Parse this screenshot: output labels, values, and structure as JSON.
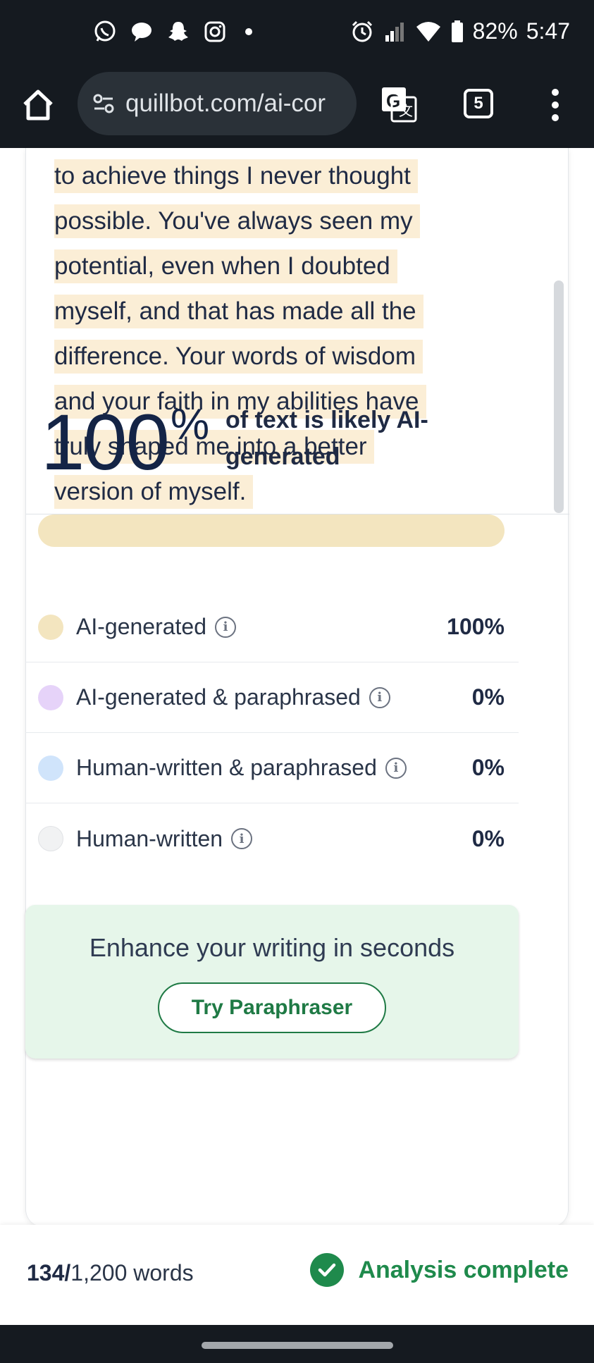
{
  "status_bar": {
    "icons_left": [
      "whatsapp-icon",
      "chat-bubble-icon",
      "snapchat-icon",
      "instagram-icon",
      "notification-dot"
    ],
    "icons_right": [
      "alarm-icon",
      "signal-icon",
      "wifi-icon",
      "battery-icon"
    ],
    "battery": "82%",
    "time": "5:47"
  },
  "browser": {
    "url": "quillbot.com/ai-cor",
    "tab_count": "5"
  },
  "document": {
    "lines": [
      "to achieve things I never thought",
      "possible. You've always seen my",
      "potential, even when I doubted",
      "myself, and that has made all the",
      "difference. Your words of wisdom",
      "and your faith in my abilities have",
      "truly shaped me into a better",
      "version of myself."
    ],
    "highlight_color": "#fbeed6"
  },
  "result": {
    "score": "100",
    "percent_sign": "%",
    "description": "of text is likely AI-generated",
    "ai_fraction": 1.0,
    "bar_color": "#f3e5bf"
  },
  "legend": [
    {
      "label": "AI-generated",
      "value": "100%",
      "color": "#f3e5bf"
    },
    {
      "label": "AI-generated & paraphrased",
      "value": "0%",
      "color": "#e6d3f9"
    },
    {
      "label": "Human-written & paraphrased",
      "value": "0%",
      "color": "#d0e4fb"
    },
    {
      "label": "Human-written",
      "value": "0%",
      "color": "#f1f2f3"
    }
  ],
  "promo": {
    "title": "Enhance your writing in seconds",
    "button": "Try Paraphraser"
  },
  "footer": {
    "word_count": "134/",
    "word_limit": "1,200 words",
    "status": "Analysis complete"
  },
  "colors": {
    "accent_green": "#1f8a4c",
    "dark_text": "#142446"
  }
}
